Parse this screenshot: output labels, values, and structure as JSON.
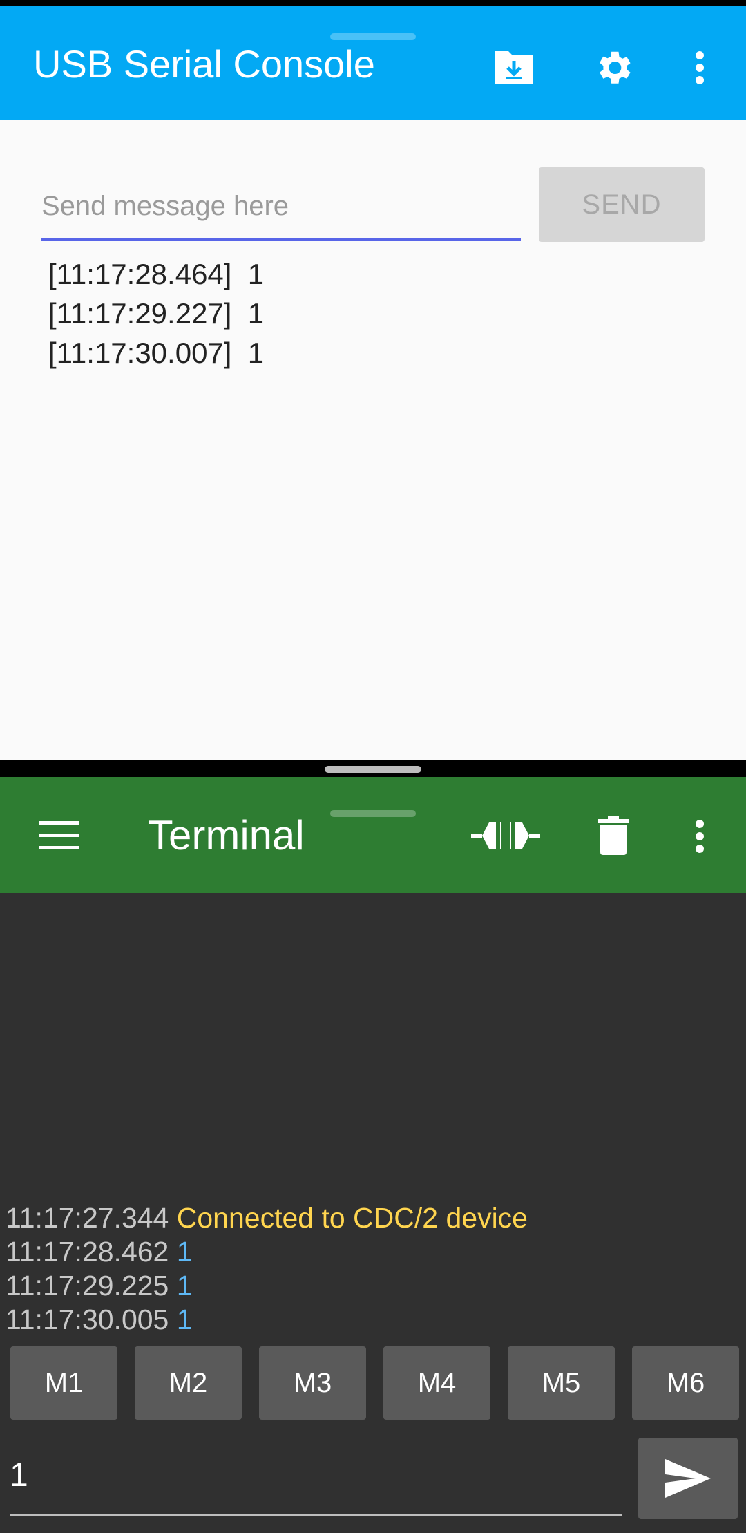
{
  "top_app": {
    "title": "USB Serial Console",
    "icons": [
      "folder-download-icon",
      "gear-icon",
      "more-vert-icon"
    ],
    "input_placeholder": "Send message here",
    "input_value": "",
    "send_label": "SEND",
    "log": [
      "[11:17:28.464]  1",
      "[11:17:29.227]  1",
      "[11:17:30.007]  1"
    ],
    "colors": {
      "bar": "#03a9f4",
      "underline": "#5865e8"
    }
  },
  "bottom_app": {
    "title": "Terminal",
    "icons": [
      "menu-icon",
      "plug-connect-icon",
      "trash-icon",
      "more-vert-icon"
    ],
    "lines": [
      {
        "time": "11:17:27.344",
        "text": "Connected to CDC/2 device",
        "kind": "status"
      },
      {
        "time": "11:17:28.462",
        "text": "1",
        "kind": "rx"
      },
      {
        "time": "11:17:29.225",
        "text": "1",
        "kind": "rx"
      },
      {
        "time": "11:17:30.005",
        "text": "1",
        "kind": "rx"
      }
    ],
    "macros": [
      "M1",
      "M2",
      "M3",
      "M4",
      "M5",
      "M6"
    ],
    "input_value": "1",
    "colors": {
      "bar": "#2e7d32",
      "status_text": "#ffd54f",
      "rx_text": "#5eb8f5"
    }
  }
}
